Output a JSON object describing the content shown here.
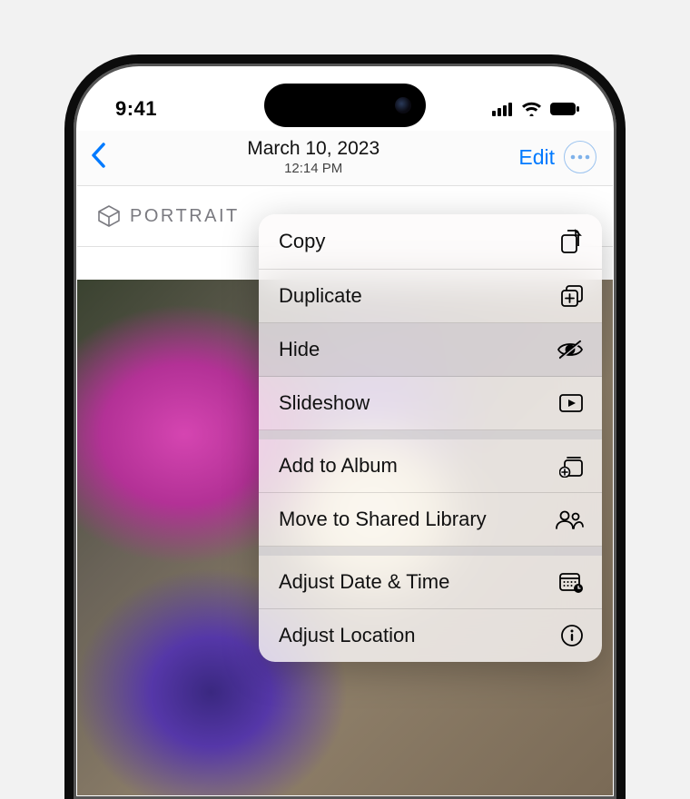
{
  "status": {
    "time": "9:41"
  },
  "nav": {
    "date": "March 10, 2023",
    "time": "12:14 PM",
    "edit_label": "Edit"
  },
  "badge": {
    "label": "PORTRAIT"
  },
  "menu": {
    "copy": "Copy",
    "duplicate": "Duplicate",
    "hide": "Hide",
    "slideshow": "Slideshow",
    "add_to_album": "Add to Album",
    "move_shared": "Move to Shared Library",
    "adjust_date": "Adjust Date & Time",
    "adjust_location": "Adjust Location"
  },
  "colors": {
    "tint": "#007aff"
  }
}
